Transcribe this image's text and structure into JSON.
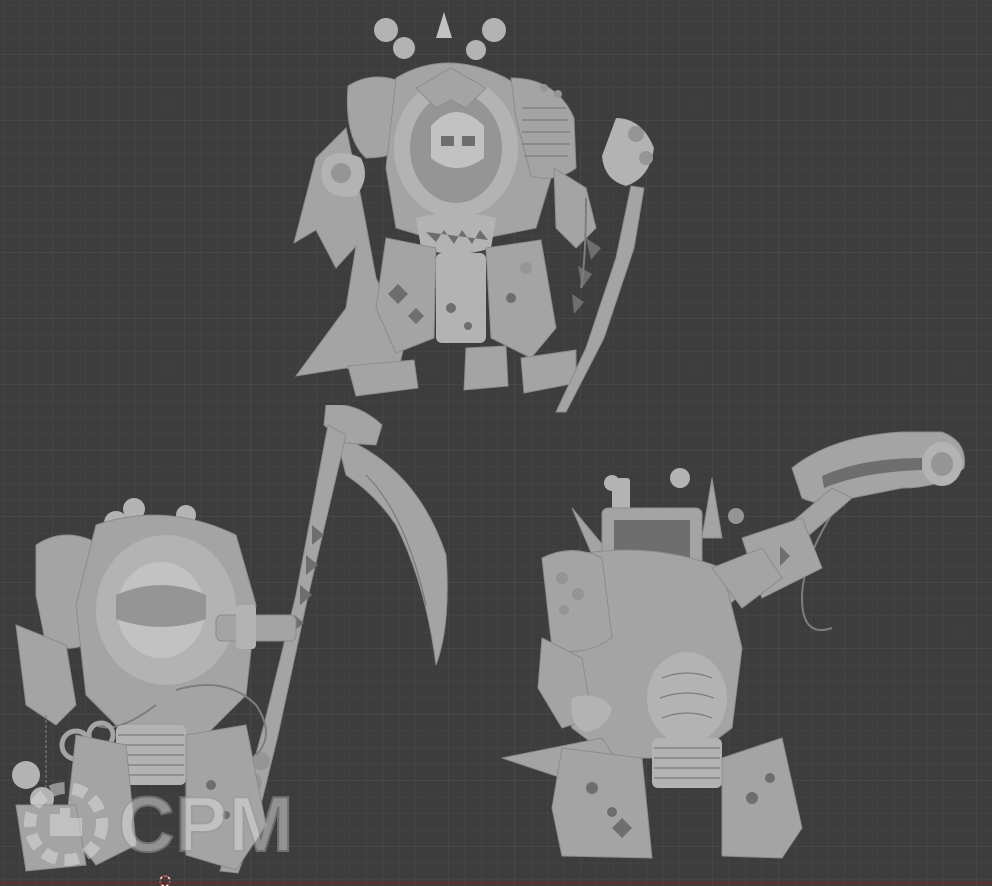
{
  "viewport": {
    "background": "#3d3d3d",
    "grid_major_color": "#474747",
    "grid_minor_color": "#434343",
    "model_color": "#a4a4a4"
  },
  "watermark": {
    "text": "CPM",
    "icon": "gear-hand-logo-icon"
  },
  "models": [
    {
      "name": "model-top-with-sword",
      "weapon": "sword-icon"
    },
    {
      "name": "model-left-with-scythe",
      "weapon": "scythe-icon"
    },
    {
      "name": "model-right-with-crusher-staff",
      "weapon": "crusher-staff-icon"
    }
  ],
  "origin_marker_icon": "3d-cursor-icon"
}
